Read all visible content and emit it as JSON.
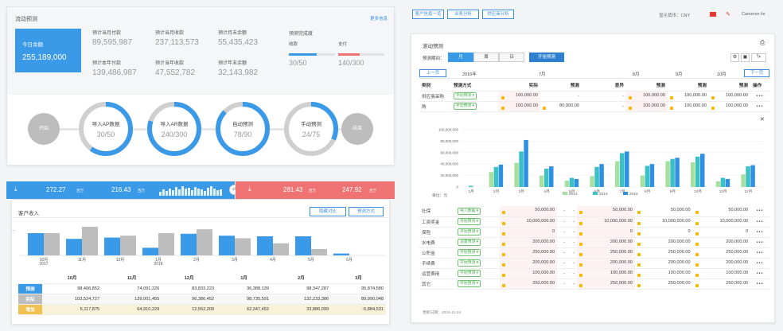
{
  "panel1": {
    "title": "流动预测",
    "more": "更多信息",
    "today": {
      "label": "今日余额",
      "value": "255,189,000"
    },
    "metrics": [
      {
        "label": "预计当月付款",
        "value": "89,595,987"
      },
      {
        "label": "预计当月收款",
        "value": "237,113,573"
      },
      {
        "label": "预计月末余额",
        "value": "55,435,423"
      },
      {
        "label": "预计本年付款",
        "value": "139,486,987"
      },
      {
        "label": "预计当年收款",
        "value": "47,552,782"
      },
      {
        "label": "预计年末余额",
        "value": "32,143,982"
      }
    ],
    "completion": {
      "title": "预测完成度",
      "items": [
        {
          "label": "收款",
          "value": "30/50",
          "progress": 0.6,
          "color": "#3b9ae8"
        },
        {
          "label": "支付",
          "value": "140/300",
          "progress": 0.47,
          "color": "#f07373"
        }
      ]
    },
    "steps": {
      "start": "开始",
      "end": "结束",
      "items": [
        {
          "label": "导入AP数据",
          "value": "30/50",
          "progress": 0.6
        },
        {
          "label": "导入AR数据",
          "value": "240/300",
          "progress": 0.8
        },
        {
          "label": "自动预测",
          "value": "78/90",
          "progress": 0.87
        },
        {
          "label": "手动预测",
          "value": "24/75",
          "progress": 0.32
        }
      ]
    }
  },
  "panel2": {
    "bar_left": {
      "v1": "272.27",
      "u1": "百万",
      "v2": "216.43",
      "u2": "百万"
    },
    "bar_right": {
      "v1": "281.43",
      "u1": "百万",
      "v2": "247.92",
      "u2": "百万"
    },
    "title": "客户收入",
    "btn_hide": "隐藏对比",
    "btn_mode": "预测方式",
    "chart_data": {
      "type": "bar",
      "categories": [
        "10月\n2017",
        "11月",
        "12月",
        "1月\n2018",
        "2月",
        "3月",
        "4月",
        "5月",
        "6月"
      ],
      "series": [
        {
          "values": [
            35,
            26,
            28,
            12,
            34,
            31,
            30,
            30,
            3
          ]
        },
        {
          "values": [
            35,
            45,
            31,
            35,
            41,
            27,
            19,
            10,
            0
          ]
        }
      ],
      "ylim": [
        0,
        50
      ]
    },
    "table": {
      "cols": [
        "10月",
        "11月",
        "12月",
        "1月",
        "2月",
        "3月"
      ],
      "rows": [
        {
          "label": "预测",
          "color": "#3b9ae8",
          "vals": [
            "98,406,852",
            "74,091,226",
            "83,833,223",
            "36,388,139",
            "98,347,287",
            "95,874,580"
          ]
        },
        {
          "label": "实际",
          "color": "#bdbdbd",
          "vals": [
            "103,524,727",
            "139,001,455",
            "96,386,452",
            "98,735,591",
            "132,233,386",
            "89,990,048"
          ]
        },
        {
          "label": "增加",
          "color": "#f0c050",
          "vals": [
            "5,117,875",
            "64,910,229",
            "12,552,209",
            "62,347,452",
            "33,886,099",
            "-5,884,531"
          ]
        }
      ]
    }
  },
  "panel3": {
    "tabs": [
      "客户信息一览",
      "业务分析",
      "供应商分析"
    ],
    "currency": "显示货币：CNY",
    "user": "Cameron lie",
    "title": "滚动预测",
    "period_label": "预测期间：",
    "periods": [
      "月",
      "周",
      "日"
    ],
    "start_btn": "开始预测",
    "nav": {
      "prev": "上一页",
      "next": "下一页",
      "year": "2016年",
      "months": [
        "7月",
        "8月",
        "9月",
        "10月"
      ]
    },
    "headers": [
      "类别",
      "预测方式",
      "实际",
      "预测",
      "差异",
      "预测",
      "预测",
      "预测",
      "操作"
    ],
    "rows_top": [
      {
        "cat": "供应商采购",
        "tag": "手动预测",
        "vals": [
          "100,000.00",
          "-",
          "-",
          "100,000.00",
          "100,000.00",
          "100,000.00"
        ],
        "locks": [
          true,
          false,
          false,
          true,
          true,
          true
        ]
      },
      {
        "cat": "购",
        "tag": "手动预测",
        "vals": [
          "100,000.00",
          "80,000.00",
          "-",
          "100,000.00",
          "100,000.00",
          "100,000.00"
        ],
        "locks": [
          true,
          true,
          false,
          true,
          true,
          true
        ]
      }
    ],
    "chart_data": {
      "type": "bar",
      "categories": [
        "1月",
        "2月",
        "3月",
        "4月",
        "5月",
        "6月",
        "7月",
        "8月",
        "9月",
        "10月",
        "11月",
        "12月"
      ],
      "series": [
        {
          "name": "2014",
          "values": [
            0,
            2600000,
            4200000,
            2000000,
            1100000,
            1900000,
            4500000,
            2000000,
            4500000,
            4300000,
            1000000,
            2200000
          ]
        },
        {
          "name": "2015",
          "values": [
            200000,
            3500000,
            6200000,
            3200000,
            1600000,
            3500000,
            5900000,
            3700000,
            4900000,
            5300000,
            1600000,
            3600000
          ]
        },
        {
          "name": "2016",
          "values": [
            0,
            3900000,
            8200000,
            3600000,
            1400000,
            4000000,
            6200000,
            4000000,
            5100000,
            5800000,
            1400000,
            3800000
          ]
        }
      ],
      "yticks": [
        "100,000,000",
        "80,000,000",
        "60,000,000",
        "40,000,000",
        "20,000,000",
        "0"
      ],
      "ylim": [
        0,
        10000000
      ],
      "unit": "单位：元"
    },
    "rows_bottom": [
      {
        "cat": "社保",
        "tag": "导入数据",
        "vals": [
          "50,000.00",
          "-",
          "-",
          "50,000.00",
          "50,000.00",
          "50,000.00"
        ]
      },
      {
        "cat": "工资奖金",
        "tag": "开始预测",
        "vals": [
          "10,000,000.00",
          "-",
          "-",
          "10,000,000.00",
          "10,000,000.00",
          "10,000,000.00"
        ]
      },
      {
        "cat": "保险",
        "tag": "开始预测",
        "vals": [
          "0",
          "-",
          "-",
          "0",
          "0",
          "0"
        ]
      },
      {
        "cat": "水电费",
        "tag": "设置预测",
        "vals": [
          "200,000.00",
          "-",
          "-",
          "200,000.00",
          "200,000.00",
          "200,000.00"
        ]
      },
      {
        "cat": "公积金",
        "tag": "开始预测",
        "vals": [
          "250,000.00",
          "-",
          "-",
          "250,000.00",
          "250,000.00",
          "250,000.00"
        ]
      },
      {
        "cat": "手续费",
        "tag": "开始预测",
        "vals": [
          "200,000.00",
          "-",
          "-",
          "200,000.00",
          "200,000.00",
          "200,000.00"
        ]
      },
      {
        "cat": "运营费用",
        "tag": "开始预测",
        "vals": [
          "100,000.00",
          "-",
          "-",
          "100,000.00",
          "100,000.00",
          "100,000.00"
        ]
      },
      {
        "cat": "其它",
        "tag": "开始预测",
        "vals": [
          "250,000.00",
          "-",
          "-",
          "250,000.00",
          "250,000.00",
          "250,000.00"
        ]
      }
    ],
    "footer": "更新日期：2016-11-24"
  }
}
